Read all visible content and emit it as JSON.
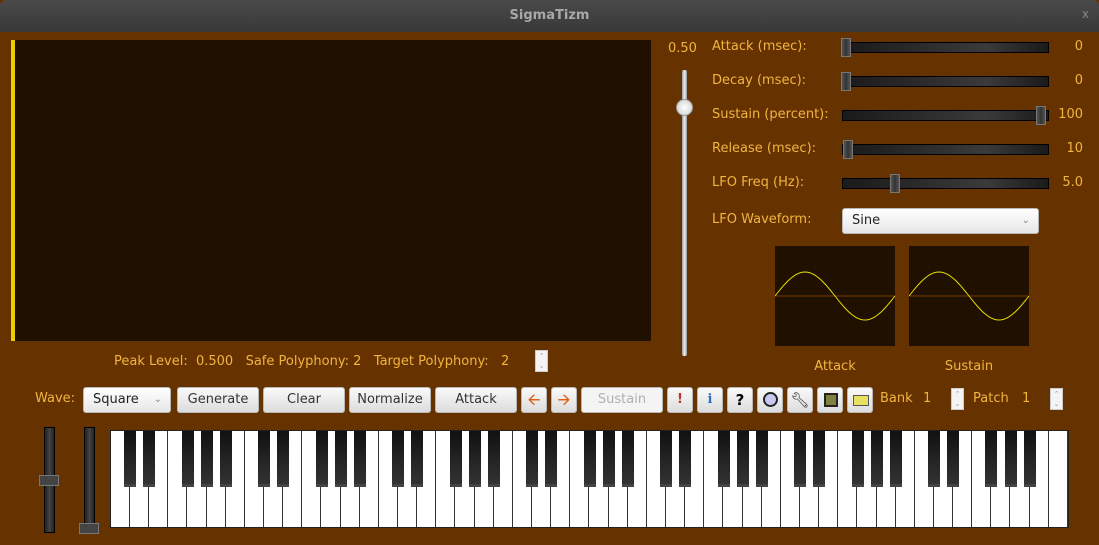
{
  "window": {
    "title": "SigmaTizm",
    "close": "x"
  },
  "volume": {
    "label": "0.50",
    "value": 0.5
  },
  "envelope": [
    {
      "label": "Attack (msec):",
      "value": "0",
      "fraction": 0
    },
    {
      "label": "Decay (msec):",
      "value": "0",
      "fraction": 0
    },
    {
      "label": "Sustain (percent):",
      "value": "100",
      "fraction": 1
    },
    {
      "label": "Release (msec):",
      "value": "10",
      "fraction": 0.01
    },
    {
      "label": "LFO Freq (Hz):",
      "value": "5.0",
      "fraction": 0.25
    }
  ],
  "lfo": {
    "label": "LFO Waveform:",
    "selected": "Sine"
  },
  "scopes": {
    "attack": "Attack",
    "sustain": "Sustain"
  },
  "status": {
    "peak_label": "Peak Level:",
    "peak": "0.500",
    "safe_label": "Safe Polyphony:",
    "safe": "2",
    "target_label": "Target Polyphony:",
    "target": "2"
  },
  "toolbar": {
    "wave_label": "Wave:",
    "wave": "Square",
    "generate": "Generate",
    "clear": "Clear",
    "normalize": "Normalize",
    "attack": "Attack",
    "sustain": "Sustain",
    "bank_label": "Bank",
    "bank": "1",
    "patch_label": "Patch",
    "patch": "1"
  },
  "icons": [
    "arrow-left-icon",
    "arrow-right-icon",
    "alert-icon",
    "info-icon",
    "help-icon",
    "midi-icon",
    "wrench-icon",
    "save-icon",
    "open-folder-icon"
  ],
  "colors": {
    "background": "#663300",
    "text": "#f2b440",
    "display": "#201000",
    "trace": "#e8e000"
  },
  "wheels": {
    "pitch": 0.5,
    "mod": 0
  },
  "keyboard": {
    "white_keys": 50,
    "start_note": "C"
  }
}
